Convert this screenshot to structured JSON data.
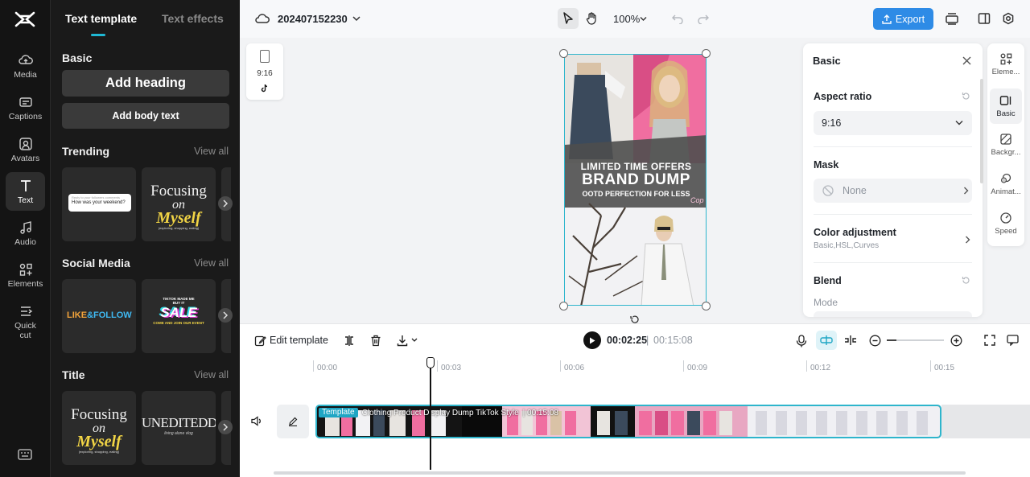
{
  "rail": {
    "items": [
      {
        "label": "Media",
        "icon": "media-cloud-icon"
      },
      {
        "label": "Captions",
        "icon": "captions-icon"
      },
      {
        "label": "Avatars",
        "icon": "avatars-icon"
      },
      {
        "label": "Text",
        "icon": "text-icon"
      },
      {
        "label": "Audio",
        "icon": "audio-icon"
      },
      {
        "label": "Elements",
        "icon": "elements-icon"
      },
      {
        "label": "Quick cut",
        "icon": "quick-cut-icon"
      }
    ],
    "active": "Text"
  },
  "panel": {
    "tabs": [
      "Text template",
      "Text effects"
    ],
    "basic": {
      "title": "Basic",
      "add_heading": "Add heading",
      "add_body": "Add body text"
    },
    "trending": {
      "title": "Trending",
      "view_all": "View all",
      "card1_question": "How was your weekend?",
      "card1_small": "Reply to your followers comments",
      "card2_line1": "Focusing",
      "card2_line2": "on",
      "card2_line3": "Myself",
      "card2_tagline": "(exploring, shopping, eating)"
    },
    "social": {
      "title": "Social Media",
      "view_all": "View all",
      "card1_like": "LIKE",
      "card1_follow": "&FOLLOW",
      "card2_top": "TIKTOK MADE ME BUY IT",
      "card2_sale": "SALE",
      "card2_bottom": "COME AND JOIN OUR EVENT"
    },
    "title_section": {
      "title": "Title",
      "view_all": "View all",
      "card1_line1": "Focusing",
      "card1_line2": "on",
      "card1_line3": "Myself",
      "card1_tagline": "(exploring, shopping, eating)",
      "card2_main": "UNEDITEDDAY",
      "card2_sub": "living alone vlog"
    }
  },
  "topbar": {
    "project_name": "202407152230",
    "zoom": "100%",
    "export_label": "Export"
  },
  "canvas": {
    "ratio_label": "9:16",
    "preview": {
      "line1": "LIMITED TIME OFFERS",
      "line2": "BRAND DUMP",
      "line3": "OOTD PERFECTION FOR LESS",
      "corner": "Cop"
    }
  },
  "properties": {
    "title": "Basic",
    "aspect_ratio_label": "Aspect ratio",
    "aspect_ratio_value": "9:16",
    "mask_label": "Mask",
    "mask_value": "None",
    "color_adjustment_label": "Color adjustment",
    "color_adjustment_sub": "Basic,HSL,Curves",
    "blend_label": "Blend",
    "blend_mode_label": "Mode"
  },
  "right_rail": {
    "items": [
      {
        "label": "Eleme...",
        "icon": "elements-icon"
      },
      {
        "label": "Basic",
        "icon": "basic-icon"
      },
      {
        "label": "Backgr...",
        "icon": "background-icon"
      },
      {
        "label": "Animat...",
        "icon": "animation-icon"
      },
      {
        "label": "Speed",
        "icon": "speed-icon"
      }
    ],
    "active": "Basic"
  },
  "timeline": {
    "edit_template": "Edit template",
    "current_time": "00:02:25",
    "separator": "|",
    "total_time": "00:15:08",
    "ruler": [
      "00:00",
      "00:03",
      "00:06",
      "00:09",
      "00:12",
      "00:15"
    ],
    "clip_badge": "Template",
    "clip_title": "Clothing Product Display Dump TikTok Style",
    "clip_duration": "| 00:15:08"
  },
  "colors": {
    "accent": "#2eb5cc",
    "export": "#2e8be6",
    "panel_bg": "#1a1a1a",
    "rail_bg": "#141414"
  }
}
